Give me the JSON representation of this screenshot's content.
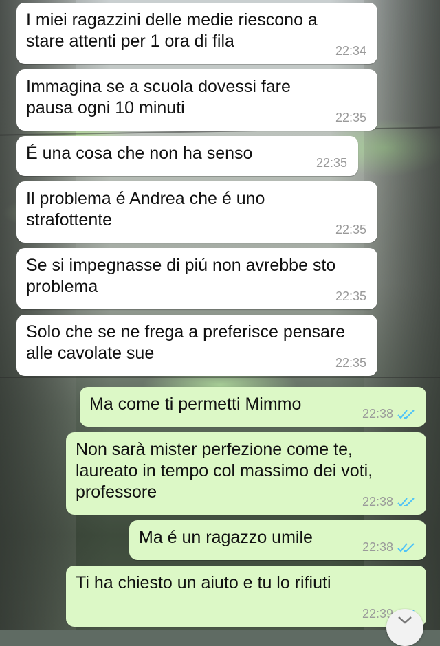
{
  "messages": [
    {
      "direction": "incoming",
      "text": "I miei ragazzini delle medie riescono a\nstare attenti per 1 ora di fila",
      "time": "22:34"
    },
    {
      "direction": "incoming",
      "text": "Immagina se a scuola dovessi fare\npausa ogni 10 minuti",
      "time": "22:35"
    },
    {
      "direction": "incoming",
      "text": "É una cosa che non ha senso",
      "time": "22:35"
    },
    {
      "direction": "incoming",
      "text": "Il problema é Andrea che é uno\nstrafottente",
      "time": "22:35"
    },
    {
      "direction": "incoming",
      "text": "Se si impegnasse di piú non avrebbe sto\nproblema",
      "time": "22:35"
    },
    {
      "direction": "incoming",
      "text": "Solo che se ne frega a preferisce pensare\nalle cavolate sue",
      "time": "22:35"
    },
    {
      "direction": "outgoing",
      "text": "Ma come ti permetti Mimmo",
      "time": "22:38",
      "status": "read"
    },
    {
      "direction": "outgoing",
      "text": "Non sarà mister perfezione come te,\nlaureato in tempo col massimo dei voti,\nprofessore",
      "time": "22:38",
      "status": "read"
    },
    {
      "direction": "outgoing",
      "text": "Ma é un ragazzo umile",
      "time": "22:38",
      "status": "read"
    },
    {
      "direction": "outgoing",
      "text": "Ti ha chiesto un aiuto e tu lo rifiuti",
      "time": "22:39",
      "status": "read"
    }
  ],
  "colors": {
    "incoming_bubble": "#ffffff",
    "outgoing_bubble": "#dcf8c6",
    "read_ticks": "#4fc3f7",
    "timestamp": "#9a9a9a"
  },
  "icons": {
    "read_status": "double-check-icon",
    "scroll": "chevron-down-icon"
  }
}
